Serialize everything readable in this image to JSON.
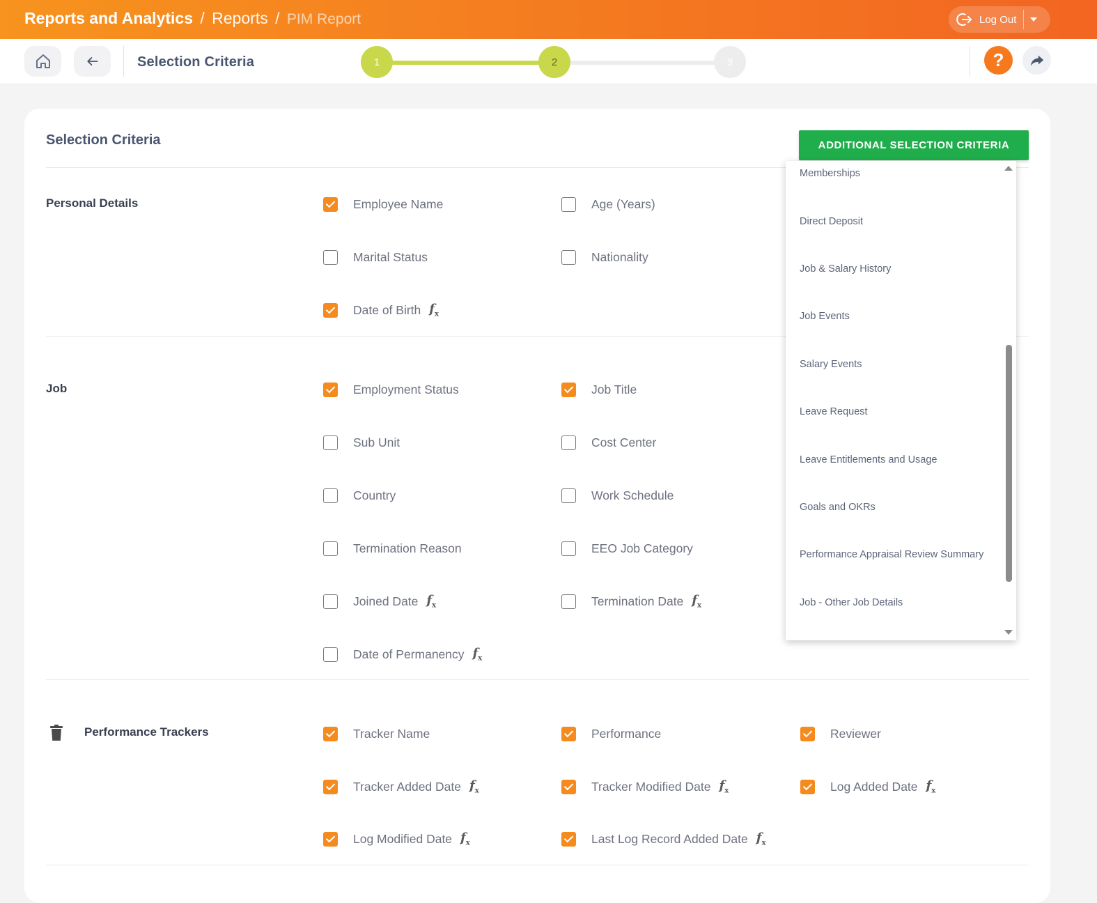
{
  "breadcrumb": {
    "module": "Reports and Analytics",
    "section": "Reports",
    "page": "PIM Report",
    "separator": "/"
  },
  "header": {
    "logout_label": "Log Out"
  },
  "subbar": {
    "title": "Selection Criteria",
    "help_label": "?"
  },
  "stepper": {
    "steps": [
      "1",
      "2",
      "3"
    ],
    "current": 2,
    "active_color": "#c8d84a",
    "inactive_color": "#ededed"
  },
  "card": {
    "title": "Selection Criteria",
    "add_button_label": "ADDITIONAL SELECTION CRITERIA"
  },
  "sections": {
    "personal": {
      "title": "Personal Details",
      "fields": [
        {
          "label": "Employee Name",
          "checked": true,
          "fx": false
        },
        {
          "label": "Age (Years)",
          "checked": false,
          "fx": false
        },
        {
          "label": "Marital Status",
          "checked": false,
          "fx": false
        },
        {
          "label": "Nationality",
          "checked": false,
          "fx": false
        },
        {
          "label": "Date of Birth",
          "checked": true,
          "fx": true
        }
      ]
    },
    "job": {
      "title": "Job",
      "fields": [
        {
          "label": "Employment Status",
          "checked": true,
          "fx": false
        },
        {
          "label": "Job Title",
          "checked": true,
          "fx": false
        },
        {
          "label": "Sub Unit",
          "checked": false,
          "fx": false
        },
        {
          "label": "Cost Center",
          "checked": false,
          "fx": false
        },
        {
          "label": "Country",
          "checked": false,
          "fx": false
        },
        {
          "label": "Work Schedule",
          "checked": false,
          "fx": false
        },
        {
          "label": "Termination Reason",
          "checked": false,
          "fx": false
        },
        {
          "label": "EEO Job Category",
          "checked": false,
          "fx": false
        },
        {
          "label": "Joined Date",
          "checked": false,
          "fx": true
        },
        {
          "label": "Termination Date",
          "checked": false,
          "fx": true
        },
        {
          "label": "Date of Permanency",
          "checked": false,
          "fx": true
        }
      ]
    },
    "performance": {
      "title": "Performance Trackers",
      "fields": [
        {
          "label": "Tracker Name",
          "checked": true,
          "fx": false
        },
        {
          "label": "Performance",
          "checked": true,
          "fx": false
        },
        {
          "label": "Reviewer",
          "checked": true,
          "fx": false
        },
        {
          "label": "Tracker Added Date",
          "checked": true,
          "fx": true
        },
        {
          "label": "Tracker Modified Date",
          "checked": true,
          "fx": true
        },
        {
          "label": "Log Added Date",
          "checked": true,
          "fx": true
        },
        {
          "label": "Log Modified Date",
          "checked": true,
          "fx": true
        },
        {
          "label": "Last Log Record Added Date",
          "checked": true,
          "fx": true
        }
      ]
    }
  },
  "dropdown": {
    "items": [
      "Memberships",
      "Direct Deposit",
      "Job & Salary History",
      "Job Events",
      "Salary Events",
      "Leave Request",
      "Leave Entitlements and Usage",
      "Goals and OKRs",
      "Performance Appraisal Review Summary",
      "Job - Other Job Details"
    ]
  },
  "colors": {
    "accent": "#f58b1f",
    "header_start": "#f7931e",
    "header_end": "#f26522",
    "button_green": "#1fae4b"
  }
}
